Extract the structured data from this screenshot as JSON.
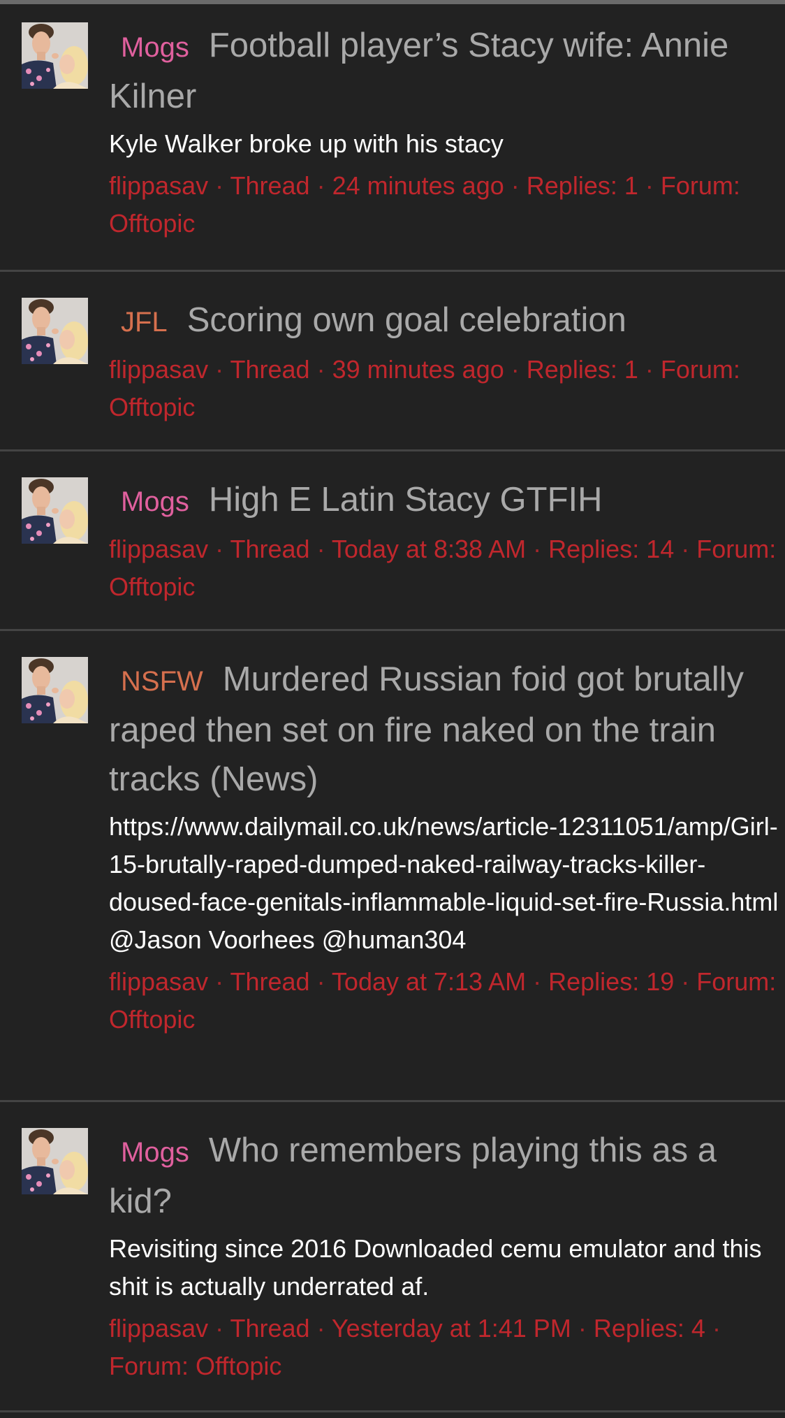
{
  "threads": [
    {
      "prefix": "Mogs",
      "title": "Football player’s Stacy wife: Annie Kilner",
      "snippet": "Kyle Walker broke up with his stacy",
      "author": "flippasav",
      "type": "Thread",
      "time": "24 minutes ago",
      "replies": "Replies: 1",
      "forum": "Forum: Offtopic"
    },
    {
      "prefix": "JFL",
      "title": "Scoring own goal celebration",
      "snippet": "",
      "author": "flippasav",
      "type": "Thread",
      "time": "39 minutes ago",
      "replies": "Replies: 1",
      "forum": "Forum: Offtopic"
    },
    {
      "prefix": "Mogs",
      "title": "High E Latin Stacy GTFIH",
      "snippet": "",
      "author": "flippasav",
      "type": "Thread",
      "time": "Today at 8:38 AM",
      "replies": "Replies: 14",
      "forum": "Forum: Offtopic"
    },
    {
      "prefix": "NSFW",
      "title": "Murdered Russian foid got brutally raped then set on fire naked on the train tracks (News)",
      "snippet": "https://www.dailymail.co.uk/news/article-12311051/amp/Girl-15-brutally-raped-dumped-naked-railway-tracks-killer-doused-face-genitals-inflammable-liquid-set-fire-Russia.html @Jason Voorhees @human304",
      "author": "flippasav",
      "type": "Thread",
      "time": "Today at 7:13 AM",
      "replies": "Replies: 19",
      "forum": "Forum: Offtopic"
    },
    {
      "prefix": "Mogs",
      "title": "Who remembers playing this as a kid?",
      "snippet": "Revisiting since 2016 Downloaded cemu emulator and this shit is actually underrated af.",
      "author": "flippasav",
      "type": "Thread",
      "time": "Yesterday at 1:41 PM",
      "replies": "Replies: 4",
      "forum": "Forum: Offtopic"
    }
  ],
  "meta_separator": "·",
  "colors": {
    "background": "#222222",
    "meta_red": "#c0272d",
    "prefix_mogs": "#e0609e",
    "prefix_jfl": "#d6704e",
    "title_gray": "#a9a9a9"
  },
  "icons": {
    "avatar": "user-avatar-photo"
  }
}
